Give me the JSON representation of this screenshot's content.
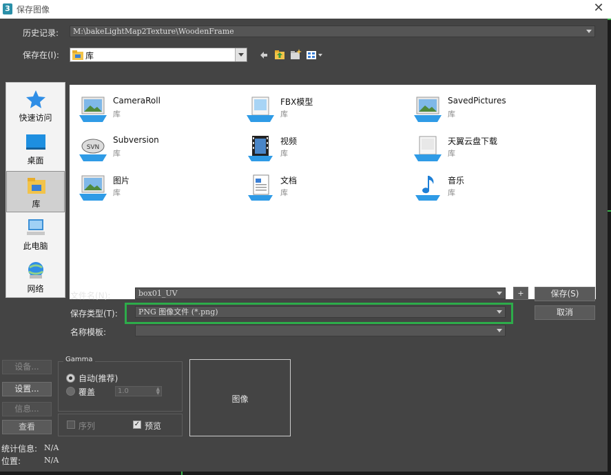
{
  "window": {
    "title": "保存图像",
    "app_icon": "3"
  },
  "history": {
    "label": "历史记录:",
    "value": "M:\\bakeLightMap2Texture\\WoodenFrame"
  },
  "save_in": {
    "label": "保存在(I):",
    "value": "库"
  },
  "places": [
    {
      "label": "快速访问",
      "icon": "star-icon"
    },
    {
      "label": "桌面",
      "icon": "desktop-icon"
    },
    {
      "label": "库",
      "icon": "library-icon"
    },
    {
      "label": "此电脑",
      "icon": "computer-icon"
    },
    {
      "label": "网络",
      "icon": "network-icon"
    }
  ],
  "files": [
    {
      "name": "CameraRoll",
      "type": "库"
    },
    {
      "name": "FBX模型",
      "type": "库"
    },
    {
      "name": "SavedPictures",
      "type": "库"
    },
    {
      "name": "Subversion",
      "type": "库"
    },
    {
      "name": "视频",
      "type": "库"
    },
    {
      "name": "天翼云盘下载",
      "type": "库"
    },
    {
      "name": "图片",
      "type": "库"
    },
    {
      "name": "文档",
      "type": "库"
    },
    {
      "name": "音乐",
      "type": "库"
    }
  ],
  "filename": {
    "label": "文件名(N):",
    "value": "box01_UV"
  },
  "filetype": {
    "label": "保存类型(T):",
    "value": "PNG 图像文件 (*.png)"
  },
  "template": {
    "label": "名称模板:",
    "value": ""
  },
  "buttons": {
    "plus": "+",
    "save": "保存(S)",
    "cancel": "取消"
  },
  "left_buttons": {
    "setup_disabled": "设备...",
    "setup": "设置...",
    "info": "信息...",
    "view": "查看"
  },
  "gamma": {
    "title": "Gamma",
    "auto": "自动(推荐)",
    "override": "覆盖",
    "override_value": "1.0"
  },
  "options": {
    "sequence": "序列",
    "preview": "预览"
  },
  "preview": {
    "label": "图像"
  },
  "stats": {
    "label": "统计信息:",
    "value": "N/A"
  },
  "location": {
    "label": "位置:",
    "value": "N/A"
  },
  "colors": {
    "highlight": "#2dac4a",
    "background": "#444444"
  }
}
